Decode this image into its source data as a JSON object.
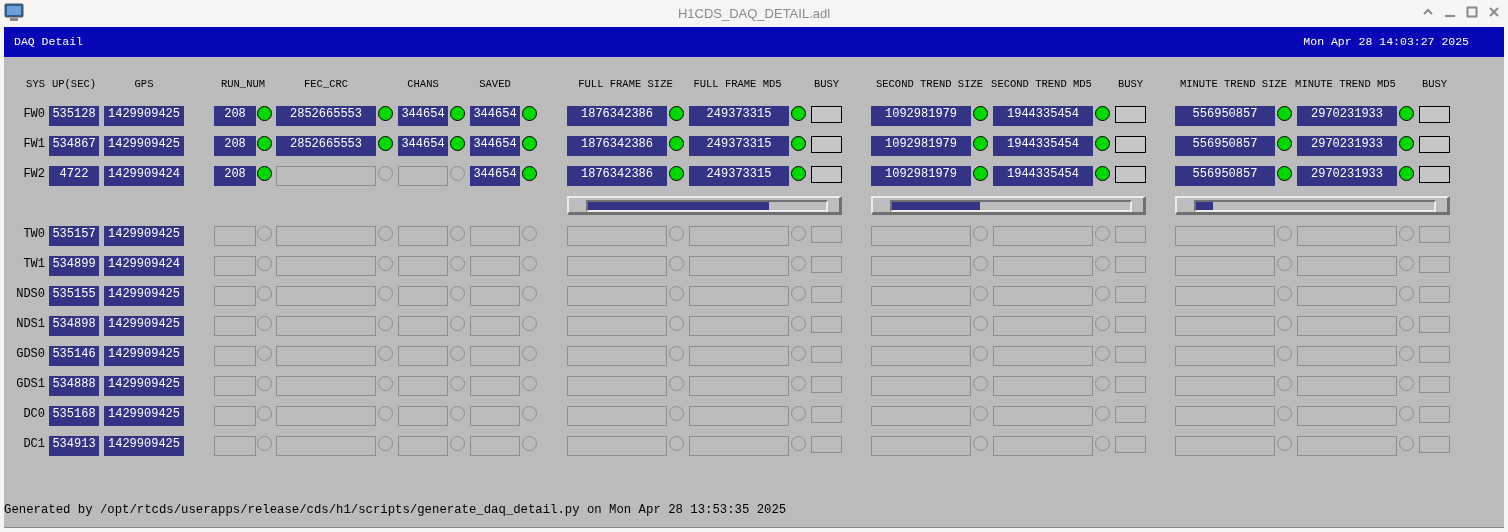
{
  "window": {
    "title": "H1CDS_DAQ_DETAIL.adl"
  },
  "banner": {
    "title": "DAQ Detail",
    "timestamp": "Mon Apr 28 14:03:27 2025"
  },
  "columns": [
    "SYS",
    "UP(SEC)",
    "GPS",
    "RUN_NUM",
    "FEC_CRC",
    "CHANS",
    "SAVED"
  ],
  "trend_groups": [
    {
      "size_label": "FULL FRAME SIZE",
      "md5_label": "FULL FRAME MD5",
      "busy_label": "BUSY",
      "level": 0.76
    },
    {
      "size_label": "SECOND TREND SIZE",
      "md5_label": "SECOND TREND MD5",
      "busy_label": "BUSY",
      "level": 0.37
    },
    {
      "size_label": "MINUTE TREND SIZE",
      "md5_label": "MINUTE TREND MD5",
      "busy_label": "BUSY",
      "level": 0.07
    }
  ],
  "frame_writers": [
    {
      "sys": "FW0",
      "up": "535128",
      "gps": "1429909425",
      "fields": [
        {
          "value": "208",
          "valid": true
        },
        {
          "value": "2852665553",
          "valid": true
        },
        {
          "value": "344654",
          "valid": true
        },
        {
          "value": "344654",
          "valid": true
        }
      ],
      "trends": [
        {
          "size": {
            "value": "1876342386",
            "valid": true
          },
          "md5": {
            "value": "249373315",
            "valid": true
          },
          "busy_valid": true
        },
        {
          "size": {
            "value": "1092981979",
            "valid": true
          },
          "md5": {
            "value": "1944335454",
            "valid": true
          },
          "busy_valid": true
        },
        {
          "size": {
            "value": "556950857",
            "valid": true
          },
          "md5": {
            "value": "2970231933",
            "valid": true
          },
          "busy_valid": true
        }
      ]
    },
    {
      "sys": "FW1",
      "up": "534867",
      "gps": "1429909425",
      "fields": [
        {
          "value": "208",
          "valid": true
        },
        {
          "value": "2852665553",
          "valid": true
        },
        {
          "value": "344654",
          "valid": true
        },
        {
          "value": "344654",
          "valid": true
        }
      ],
      "trends": [
        {
          "size": {
            "value": "1876342386",
            "valid": true
          },
          "md5": {
            "value": "249373315",
            "valid": true
          },
          "busy_valid": true
        },
        {
          "size": {
            "value": "1092981979",
            "valid": true
          },
          "md5": {
            "value": "1944335454",
            "valid": true
          },
          "busy_valid": true
        },
        {
          "size": {
            "value": "556950857",
            "valid": true
          },
          "md5": {
            "value": "2970231933",
            "valid": true
          },
          "busy_valid": true
        }
      ]
    },
    {
      "sys": "FW2",
      "up": "4722",
      "gps": "1429909424",
      "fields": [
        {
          "value": "208",
          "valid": true
        },
        {
          "valid": false
        },
        {
          "valid": false
        },
        {
          "value": "344654",
          "valid": true
        }
      ],
      "trends": [
        {
          "size": {
            "value": "1876342386",
            "valid": true
          },
          "md5": {
            "value": "249373315",
            "valid": true
          },
          "busy_valid": true
        },
        {
          "size": {
            "value": "1092981979",
            "valid": true
          },
          "md5": {
            "value": "1944335454",
            "valid": true
          },
          "busy_valid": true
        },
        {
          "size": {
            "value": "556950857",
            "valid": true
          },
          "md5": {
            "value": "2970231933",
            "valid": true
          },
          "busy_valid": true
        }
      ]
    }
  ],
  "other_systems": [
    {
      "sys": "TW0",
      "up": "535157",
      "gps": "1429909425",
      "fields": [
        {
          "valid": false
        },
        {
          "valid": false
        },
        {
          "valid": false
        },
        {
          "valid": false
        }
      ],
      "trends": [
        {
          "size": {
            "valid": false
          },
          "md5": {
            "valid": false
          },
          "busy_valid": false
        },
        {
          "size": {
            "valid": false
          },
          "md5": {
            "valid": false
          },
          "busy_valid": false
        },
        {
          "size": {
            "valid": false
          },
          "md5": {
            "valid": false
          },
          "busy_valid": false
        }
      ]
    },
    {
      "sys": "TW1",
      "up": "534899",
      "gps": "1429909424",
      "fields": [
        {
          "valid": false
        },
        {
          "valid": false
        },
        {
          "valid": false
        },
        {
          "valid": false
        }
      ],
      "trends": [
        {
          "size": {
            "valid": false
          },
          "md5": {
            "valid": false
          },
          "busy_valid": false
        },
        {
          "size": {
            "valid": false
          },
          "md5": {
            "valid": false
          },
          "busy_valid": false
        },
        {
          "size": {
            "valid": false
          },
          "md5": {
            "valid": false
          },
          "busy_valid": false
        }
      ]
    },
    {
      "sys": "NDS0",
      "up": "535155",
      "gps": "1429909425",
      "fields": [
        {
          "valid": false
        },
        {
          "valid": false
        },
        {
          "valid": false
        },
        {
          "valid": false
        }
      ],
      "trends": [
        {
          "size": {
            "valid": false
          },
          "md5": {
            "valid": false
          },
          "busy_valid": false
        },
        {
          "size": {
            "valid": false
          },
          "md5": {
            "valid": false
          },
          "busy_valid": false
        },
        {
          "size": {
            "valid": false
          },
          "md5": {
            "valid": false
          },
          "busy_valid": false
        }
      ]
    },
    {
      "sys": "NDS1",
      "up": "534898",
      "gps": "1429909425",
      "fields": [
        {
          "valid": false
        },
        {
          "valid": false
        },
        {
          "valid": false
        },
        {
          "valid": false
        }
      ],
      "trends": [
        {
          "size": {
            "valid": false
          },
          "md5": {
            "valid": false
          },
          "busy_valid": false
        },
        {
          "size": {
            "valid": false
          },
          "md5": {
            "valid": false
          },
          "busy_valid": false
        },
        {
          "size": {
            "valid": false
          },
          "md5": {
            "valid": false
          },
          "busy_valid": false
        }
      ]
    },
    {
      "sys": "GDS0",
      "up": "535146",
      "gps": "1429909425",
      "fields": [
        {
          "valid": false
        },
        {
          "valid": false
        },
        {
          "valid": false
        },
        {
          "valid": false
        }
      ],
      "trends": [
        {
          "size": {
            "valid": false
          },
          "md5": {
            "valid": false
          },
          "busy_valid": false
        },
        {
          "size": {
            "valid": false
          },
          "md5": {
            "valid": false
          },
          "busy_valid": false
        },
        {
          "size": {
            "valid": false
          },
          "md5": {
            "valid": false
          },
          "busy_valid": false
        }
      ]
    },
    {
      "sys": "GDS1",
      "up": "534888",
      "gps": "1429909425",
      "fields": [
        {
          "valid": false
        },
        {
          "valid": false
        },
        {
          "valid": false
        },
        {
          "valid": false
        }
      ],
      "trends": [
        {
          "size": {
            "valid": false
          },
          "md5": {
            "valid": false
          },
          "busy_valid": false
        },
        {
          "size": {
            "valid": false
          },
          "md5": {
            "valid": false
          },
          "busy_valid": false
        },
        {
          "size": {
            "valid": false
          },
          "md5": {
            "valid": false
          },
          "busy_valid": false
        }
      ]
    },
    {
      "sys": "DC0",
      "up": "535168",
      "gps": "1429909425",
      "fields": [
        {
          "valid": false
        },
        {
          "valid": false
        },
        {
          "valid": false
        },
        {
          "valid": false
        }
      ],
      "trends": [
        {
          "size": {
            "valid": false
          },
          "md5": {
            "valid": false
          },
          "busy_valid": false
        },
        {
          "size": {
            "valid": false
          },
          "md5": {
            "valid": false
          },
          "busy_valid": false
        },
        {
          "size": {
            "valid": false
          },
          "md5": {
            "valid": false
          },
          "busy_valid": false
        }
      ]
    },
    {
      "sys": "DC1",
      "up": "534913",
      "gps": "1429909425",
      "fields": [
        {
          "valid": false
        },
        {
          "valid": false
        },
        {
          "valid": false
        },
        {
          "valid": false
        }
      ],
      "trends": [
        {
          "size": {
            "valid": false
          },
          "md5": {
            "valid": false
          },
          "busy_valid": false
        },
        {
          "size": {
            "valid": false
          },
          "md5": {
            "valid": false
          },
          "busy_valid": false
        },
        {
          "size": {
            "valid": false
          },
          "md5": {
            "valid": false
          },
          "busy_valid": false
        }
      ]
    }
  ],
  "footer": "Generated by /opt/rtcds/userapps/release/cds/h1/scripts/generate_daq_detail.py on Mon Apr 28 13:53:35 2025"
}
